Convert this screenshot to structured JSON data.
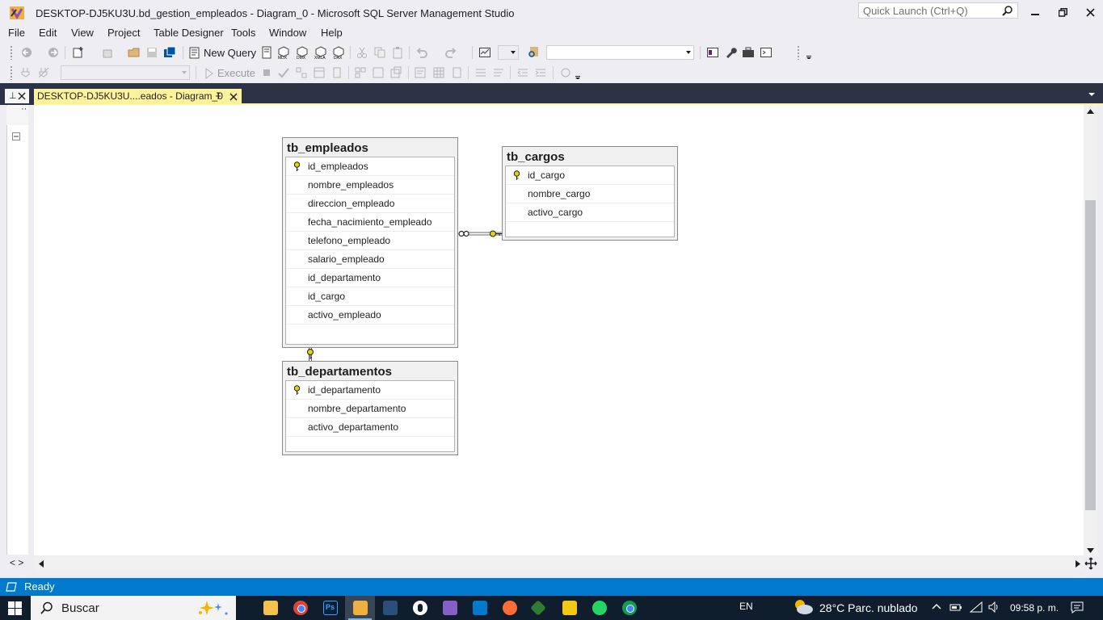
{
  "window": {
    "title": "DESKTOP-DJ5KU3U.bd_gestion_empleados - Diagram_0 - Microsoft SQL Server Management Studio",
    "quick_launch_placeholder": "Quick Launch (Ctrl+Q)"
  },
  "menu": {
    "items": [
      "File",
      "Edit",
      "View",
      "Project",
      "Table Designer",
      "Tools",
      "Window",
      "Help"
    ]
  },
  "toolbar": {
    "new_query_label": "New Query",
    "execute_label": "Execute"
  },
  "tabs": {
    "document_tab_title": "DESKTOP-DJ5KU3U....eados - Diagram_0"
  },
  "diagram": {
    "tables": [
      {
        "name": "tb_empleados",
        "columns": [
          {
            "name": "id_empleados",
            "primary_key": true
          },
          {
            "name": "nombre_empleados",
            "primary_key": false
          },
          {
            "name": "direccion_empleado",
            "primary_key": false
          },
          {
            "name": "fecha_nacimiento_empleado",
            "primary_key": false
          },
          {
            "name": "telefono_empleado",
            "primary_key": false
          },
          {
            "name": "salario_empleado",
            "primary_key": false
          },
          {
            "name": "id_departamento",
            "primary_key": false
          },
          {
            "name": "id_cargo",
            "primary_key": false
          },
          {
            "name": "activo_empleado",
            "primary_key": false
          }
        ]
      },
      {
        "name": "tb_cargos",
        "columns": [
          {
            "name": "id_cargo",
            "primary_key": true
          },
          {
            "name": "nombre_cargo",
            "primary_key": false
          },
          {
            "name": "activo_cargo",
            "primary_key": false
          }
        ]
      },
      {
        "name": "tb_departamentos",
        "columns": [
          {
            "name": "id_departamento",
            "primary_key": true
          },
          {
            "name": "nombre_departamento",
            "primary_key": false
          },
          {
            "name": "activo_departamento",
            "primary_key": false
          }
        ]
      }
    ],
    "relationships": [
      {
        "from": "tb_empleados",
        "to": "tb_cargos"
      },
      {
        "from": "tb_empleados",
        "to": "tb_departamentos"
      }
    ]
  },
  "status": {
    "text": "Ready"
  },
  "taskbar": {
    "search_placeholder": "Buscar",
    "language": "EN",
    "weather": "28°C  Parc. nublado",
    "clock": "09:58 p. m."
  },
  "colors": {
    "status_bar": "#007acc",
    "dock_band": "#2d3347",
    "active_tab": "#fff29d",
    "taskbar": "#101d2d",
    "key_icon": "#e8d200"
  }
}
